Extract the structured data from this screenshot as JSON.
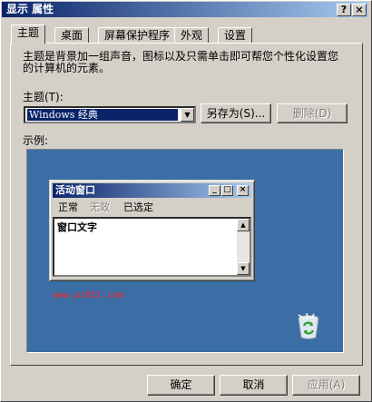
{
  "window": {
    "title": "显示 属性",
    "help_btn": "?",
    "close_btn": "×"
  },
  "tabs": [
    {
      "label": "主题",
      "active": true
    },
    {
      "label": "桌面",
      "active": false
    },
    {
      "label": "屏幕保护程序",
      "active": false
    },
    {
      "label": "外观",
      "active": false
    },
    {
      "label": "设置",
      "active": false
    }
  ],
  "theme_tab": {
    "description": "主题是背景加一组声音，图标以及只需单击即可帮您个性化设置您的计算机的元素。",
    "theme_label": "主题(T):",
    "theme_value": "Windows 经典",
    "save_as_label": "另存为(S)...",
    "delete_label": "删除(D)",
    "sample_label": "示例:"
  },
  "preview": {
    "window_title": "活动窗口",
    "menu": [
      "正常",
      "无效",
      "已选定"
    ],
    "window_text": "窗口文字",
    "watermark": "www.pc811.com"
  },
  "footer": {
    "ok_label": "确定",
    "cancel_label": "取消",
    "apply_label": "应用(A)"
  },
  "colors": {
    "title_start": "#0a246a",
    "title_end": "#a6caf0",
    "desktop": "#3a6ea5",
    "face": "#d4d0c8"
  }
}
